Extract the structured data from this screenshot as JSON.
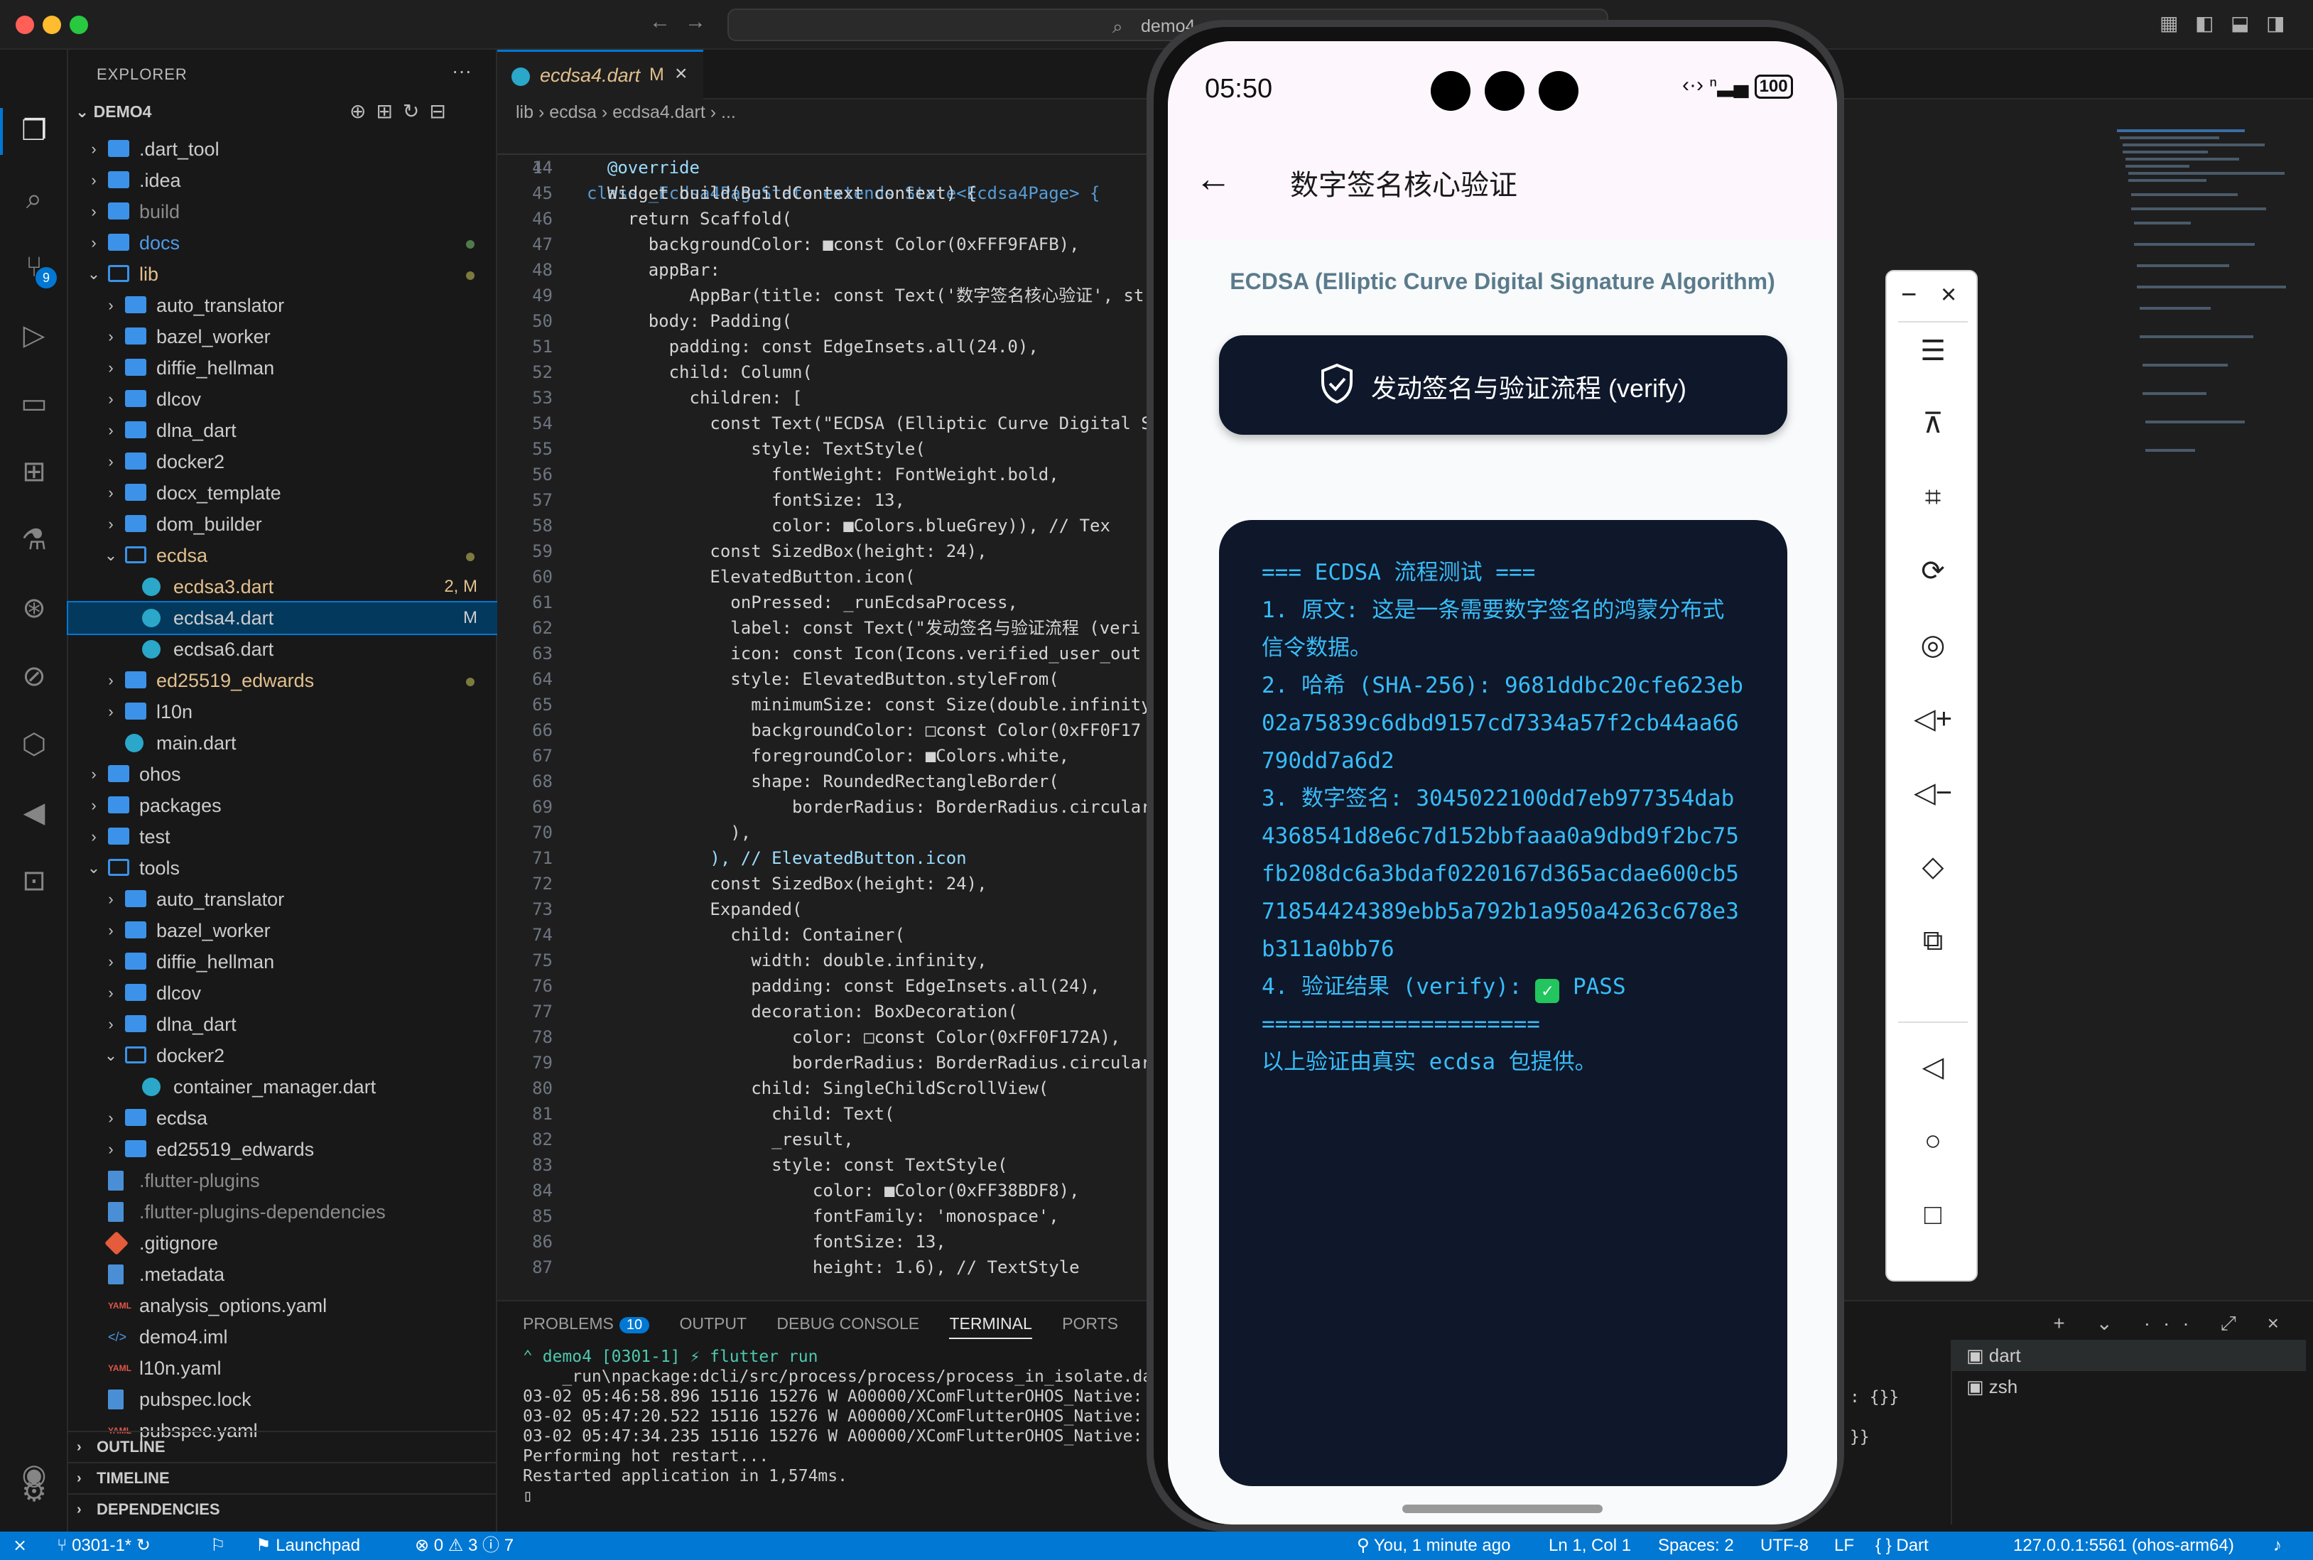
{
  "window": {
    "search_text": "demo4",
    "nav_back": "←",
    "nav_forward": "→"
  },
  "activity_bar": {
    "scm_badge": "9"
  },
  "sidebar": {
    "title": "EXPLORER",
    "more": "···",
    "root": "DEMO4",
    "tree": [
      {
        "name": ".dart_tool",
        "type": "folder",
        "depth": 1,
        "expanded": false
      },
      {
        "name": ".idea",
        "type": "folder",
        "depth": 1,
        "expanded": false
      },
      {
        "name": "build",
        "type": "folder",
        "depth": 1,
        "expanded": false,
        "muted": true
      },
      {
        "name": "docs",
        "type": "folder",
        "depth": 1,
        "expanded": false,
        "color": "#4d9be8",
        "dot": "green"
      },
      {
        "name": "lib",
        "type": "folder",
        "depth": 1,
        "expanded": true,
        "color": "#e2c08d",
        "dot": "yellow"
      },
      {
        "name": "auto_translator",
        "type": "folder",
        "depth": 2,
        "expanded": false
      },
      {
        "name": "bazel_worker",
        "type": "folder",
        "depth": 2,
        "expanded": false
      },
      {
        "name": "diffie_hellman",
        "type": "folder",
        "depth": 2,
        "expanded": false
      },
      {
        "name": "dlcov",
        "type": "folder",
        "depth": 2,
        "expanded": false
      },
      {
        "name": "dlna_dart",
        "type": "folder",
        "depth": 2,
        "expanded": false
      },
      {
        "name": "docker2",
        "type": "folder",
        "depth": 2,
        "expanded": false
      },
      {
        "name": "docx_template",
        "type": "folder",
        "depth": 2,
        "expanded": false
      },
      {
        "name": "dom_builder",
        "type": "folder",
        "depth": 2,
        "expanded": false
      },
      {
        "name": "ecdsa",
        "type": "folder",
        "depth": 2,
        "expanded": true,
        "color": "#e2c08d",
        "dot": "yellow"
      },
      {
        "name": "ecdsa3.dart",
        "type": "dart",
        "depth": 3,
        "color": "#e2c08d",
        "status": "2, M"
      },
      {
        "name": "ecdsa4.dart",
        "type": "dart",
        "depth": 3,
        "selected": true,
        "status": "M"
      },
      {
        "name": "ecdsa6.dart",
        "type": "dart",
        "depth": 3
      },
      {
        "name": "ed25519_edwards",
        "type": "folder",
        "depth": 2,
        "expanded": false,
        "color": "#e2c08d",
        "dot": "yellow"
      },
      {
        "name": "l10n",
        "type": "folder",
        "depth": 2,
        "expanded": false
      },
      {
        "name": "main.dart",
        "type": "dart",
        "depth": 2
      },
      {
        "name": "ohos",
        "type": "folder",
        "depth": 1,
        "expanded": false
      },
      {
        "name": "packages",
        "type": "folder",
        "depth": 1,
        "expanded": false
      },
      {
        "name": "test",
        "type": "folder",
        "depth": 1,
        "expanded": false
      },
      {
        "name": "tools",
        "type": "folder",
        "depth": 1,
        "expanded": true
      },
      {
        "name": "auto_translator",
        "type": "folder",
        "depth": 2,
        "expanded": false
      },
      {
        "name": "bazel_worker",
        "type": "folder",
        "depth": 2,
        "expanded": false
      },
      {
        "name": "diffie_hellman",
        "type": "folder",
        "depth": 2,
        "expanded": false
      },
      {
        "name": "dlcov",
        "type": "folder",
        "depth": 2,
        "expanded": false
      },
      {
        "name": "dlna_dart",
        "type": "folder",
        "depth": 2,
        "expanded": false
      },
      {
        "name": "docker2",
        "type": "folder",
        "depth": 2,
        "expanded": true
      },
      {
        "name": "container_manager.dart",
        "type": "dart",
        "depth": 3
      },
      {
        "name": "ecdsa",
        "type": "folder",
        "depth": 2,
        "expanded": false
      },
      {
        "name": "ed25519_edwards",
        "type": "folder",
        "depth": 2,
        "expanded": false
      },
      {
        "name": ".flutter-plugins",
        "type": "doc",
        "depth": 1,
        "muted": true
      },
      {
        "name": ".flutter-plugins-dependencies",
        "type": "doc",
        "depth": 1,
        "muted": true
      },
      {
        "name": ".gitignore",
        "type": "git",
        "depth": 1
      },
      {
        "name": ".metadata",
        "type": "doc",
        "depth": 1
      },
      {
        "name": "analysis_options.yaml",
        "type": "yaml",
        "depth": 1
      },
      {
        "name": "demo4.iml",
        "type": "xml",
        "depth": 1
      },
      {
        "name": "l10n.yaml",
        "type": "yaml",
        "depth": 1
      },
      {
        "name": "pubspec.lock",
        "type": "doc",
        "depth": 1
      },
      {
        "name": "pubspec.yaml",
        "type": "yaml",
        "depth": 1
      }
    ],
    "sections": [
      "OUTLINE",
      "TIMELINE",
      "DEPENDENCIES"
    ]
  },
  "editor": {
    "tab": {
      "name": "ecdsa4.dart",
      "modified": "M",
      "close": "×"
    },
    "breadcrumb": "lib › ecdsa › ecdsa4.dart › ...",
    "sticky": {
      "no": "14",
      "text": "class _Ecdsa4PageState extends State<Ecdsa4Page> {"
    },
    "lines": [
      {
        "no": "44",
        "text": "  @override"
      },
      {
        "no": "45",
        "text": "  Widget build(BuildContext context) {"
      },
      {
        "no": "46",
        "text": "    return Scaffold("
      },
      {
        "no": "47",
        "text": "      backgroundColor: ■const Color(0xFFF9FAFB),"
      },
      {
        "no": "48",
        "text": "      appBar:"
      },
      {
        "no": "49",
        "text": "          AppBar(title: const Text('数字签名核心验证', st"
      },
      {
        "no": "50",
        "text": "      body: Padding("
      },
      {
        "no": "51",
        "text": "        padding: const EdgeInsets.all(24.0),"
      },
      {
        "no": "52",
        "text": "        child: Column("
      },
      {
        "no": "53",
        "text": "          children: ["
      },
      {
        "no": "54",
        "text": "            const Text(\"ECDSA (Elliptic Curve Digital S"
      },
      {
        "no": "55",
        "text": "                style: TextStyle("
      },
      {
        "no": "56",
        "text": "                  fontWeight: FontWeight.bold,"
      },
      {
        "no": "57",
        "text": "                  fontSize: 13,"
      },
      {
        "no": "58",
        "text": "                  color: ■Colors.blueGrey)), // Tex"
      },
      {
        "no": "59",
        "text": "            const SizedBox(height: 24),"
      },
      {
        "no": "60",
        "text": "            ElevatedButton.icon("
      },
      {
        "no": "61",
        "text": "              onPressed: _runEcdsaProcess,"
      },
      {
        "no": "62",
        "text": "              label: const Text(\"发动签名与验证流程 (veri"
      },
      {
        "no": "63",
        "text": "              icon: const Icon(Icons.verified_user_out"
      },
      {
        "no": "64",
        "text": "              style: ElevatedButton.styleFrom("
      },
      {
        "no": "65",
        "text": "                minimumSize: const Size(double.infinity"
      },
      {
        "no": "66",
        "text": "                backgroundColor: □const Color(0xFF0F17"
      },
      {
        "no": "67",
        "text": "                foregroundColor: ■Colors.white,"
      },
      {
        "no": "68",
        "text": "                shape: RoundedRectangleBorder("
      },
      {
        "no": "69",
        "text": "                    borderRadius: BorderRadius.circular"
      },
      {
        "no": "70",
        "text": "              ),"
      },
      {
        "no": "71",
        "text": "            ), // ElevatedButton.icon"
      },
      {
        "no": "72",
        "text": "            const SizedBox(height: 24),"
      },
      {
        "no": "73",
        "text": "            Expanded("
      },
      {
        "no": "74",
        "text": "              child: Container("
      },
      {
        "no": "75",
        "text": "                width: double.infinity,"
      },
      {
        "no": "76",
        "text": "                padding: const EdgeInsets.all(24),"
      },
      {
        "no": "77",
        "text": "                decoration: BoxDecoration("
      },
      {
        "no": "78",
        "text": "                    color: □const Color(0xFF0F172A),"
      },
      {
        "no": "79",
        "text": "                    borderRadius: BorderRadius.circular"
      },
      {
        "no": "80",
        "text": "                child: SingleChildScrollView("
      },
      {
        "no": "81",
        "text": "                  child: Text("
      },
      {
        "no": "82",
        "text": "                  _result,"
      },
      {
        "no": "83",
        "text": "                  style: const TextStyle("
      },
      {
        "no": "84",
        "text": "                      color: ■Color(0xFF38BDF8),"
      },
      {
        "no": "85",
        "text": "                      fontFamily: 'monospace',"
      },
      {
        "no": "86",
        "text": "                      fontSize: 13,"
      },
      {
        "no": "87",
        "text": "                      height: 1.6), // TextStyle"
      }
    ]
  },
  "panel": {
    "tabs": [
      "PROBLEMS",
      "OUTPUT",
      "DEBUG CONSOLE",
      "TERMINAL",
      "PORTS"
    ],
    "problems_count": "10",
    "active_tab": "TERMINAL",
    "terminal_lines": [
      "⌃ demo4 [0301-1] ⚡ flutter run",
      "    _run\\npackage:dcli/src/process/process/process_in_isolate.da",
      "03-02 05:46:58.896 15116 15276 W A00000/XComFlutterOHOS_Native:",
      "03-02 05:47:20.522 15116 15276 W A00000/XComFlutterOHOS_Native:",
      "03-02 05:47:34.235 15116 15276 W A00000/XComFlutterOHOS_Native:",
      "",
      "Performing hot restart...",
      "Restarted application in 1,574ms.",
      "▯"
    ],
    "terminal_tail_1": ": {}}",
    "terminal_tail_2": "}}",
    "terminals": [
      "dart",
      "zsh"
    ],
    "toolbar": "+ ⌄ ··· ⤢ ×"
  },
  "statusbar": {
    "remote": "⨯",
    "branch": "0301-1*",
    "launchpad": "Launchpad",
    "errors": "0",
    "warnings": "3",
    "infos": "7",
    "blame": "You, 1 minute ago",
    "position": "Ln 1, Col 1",
    "spaces": "Spaces: 2",
    "encoding": "UTF-8",
    "eol": "LF",
    "language": "Dart",
    "device": "127.0.0.1:5561 (ohos-arm64)"
  },
  "phone": {
    "time": "05:50",
    "battery": "100",
    "title": "数字签名核心验证",
    "algo_label": "ECDSA (Elliptic Curve Digital Signature Algorithm)",
    "button_label": "发动签名与验证流程 (verify)",
    "result_lines": [
      "=== ECDSA 流程测试 ===",
      "1. 原文: 这是一条需要数字签名的鸿蒙分布式信令数据。",
      "2. 哈希 (SHA-256): 9681ddbc20cfe623eb02a75839c6dbd9157cd7334a57f2cb44aa66790dd7a6d2",
      "3. 数字签名: 3045022100dd7eb977354dab4368541d8e6c7d152bbfaaa0a9dbd9f2bc75fb208dc6a3bdaf0220167d365acdae600cb571854424389ebb5a792b1a950a4263c678e3b311a0bb76",
      "4. 验证结果 (verify): ",
      "=====================",
      "以上验证由真实 ecdsa 包提供。"
    ],
    "pass_label": "PASS",
    "check_glyph": "✓"
  },
  "emulator": {
    "minimize": "−",
    "close": "×"
  }
}
